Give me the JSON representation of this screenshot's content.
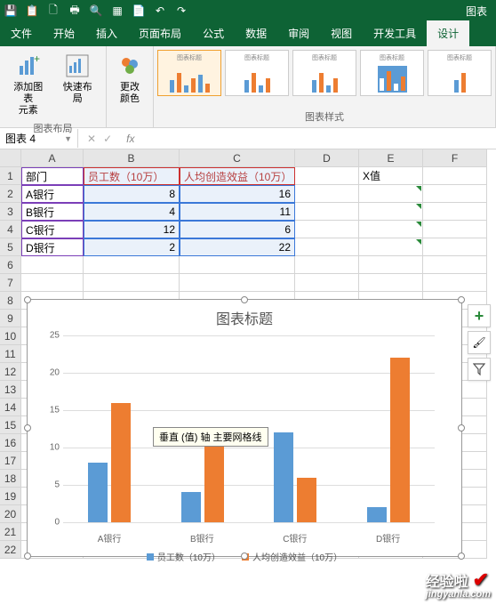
{
  "qat_icons": [
    "save-icon",
    "clipboard-icon",
    "new-icon",
    "print-icon",
    "preview-icon",
    "merge-icon",
    "paste-icon",
    "undo-icon",
    "redo-icon"
  ],
  "title_right": "图表",
  "tabs": [
    "文件",
    "开始",
    "插入",
    "页面布局",
    "公式",
    "数据",
    "审阅",
    "视图",
    "开发工具",
    "设计"
  ],
  "ribbon": {
    "layout_group_label": "图表布局",
    "add_element_label": "添加图表\n元素",
    "quick_layout_label": "快速布局",
    "change_colors_label": "更改\n颜色",
    "styles_group_label": "图表样式",
    "style_thumb_title": "图表标题"
  },
  "namebox": "图表 4",
  "formula_bar": {
    "fx": "fx",
    "value": ""
  },
  "columns": [
    "A",
    "B",
    "C",
    "D",
    "E",
    "F"
  ],
  "table": {
    "headers": [
      "部门",
      "员工数（10万）",
      "人均创造效益（10万）"
    ],
    "rows": [
      {
        "dept": "A银行",
        "emp": "8",
        "eff": "16"
      },
      {
        "dept": "B银行",
        "emp": "4",
        "eff": "11"
      },
      {
        "dept": "C银行",
        "emp": "12",
        "eff": "6"
      },
      {
        "dept": "D银行",
        "emp": "2",
        "eff": "22"
      }
    ],
    "extra_e1": "X值"
  },
  "tooltip": "垂直 (值) 轴 主要网格线",
  "chart_data": {
    "type": "bar",
    "title": "图表标题",
    "categories": [
      "A银行",
      "B银行",
      "C银行",
      "D银行"
    ],
    "series": [
      {
        "name": "员工数（10万）",
        "values": [
          8,
          4,
          12,
          2
        ],
        "color": "#5b9bd5"
      },
      {
        "name": "人均创造效益（10万）",
        "values": [
          16,
          11,
          6,
          22
        ],
        "color": "#ed7d31"
      }
    ],
    "ylim": [
      0,
      25
    ],
    "yticks": [
      0,
      5,
      10,
      15,
      20,
      25
    ],
    "xlabel": "",
    "ylabel": ""
  },
  "side_tools": {
    "plus": "+",
    "brush": "🖌",
    "filter": "▼"
  },
  "watermark": {
    "text": "经验啦",
    "domain": "jingyanla.com"
  }
}
